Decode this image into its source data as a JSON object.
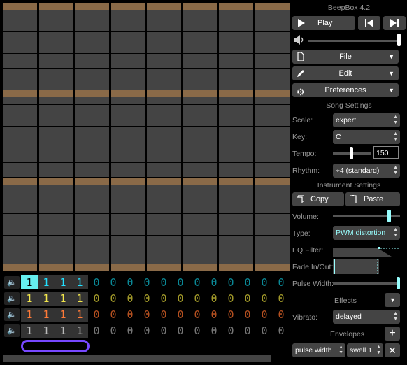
{
  "app": {
    "title": "BeepBox 4.2"
  },
  "transport": {
    "play_label": "Play",
    "play_icon": "play-icon",
    "rewind_icon": "skip-back-icon",
    "forward_icon": "skip-forward-icon",
    "volume_icon": "speaker-icon"
  },
  "menus": {
    "file": "File",
    "edit": "Edit",
    "preferences": "Preferences"
  },
  "song_settings": {
    "heading": "Song Settings",
    "scale_label": "Scale:",
    "scale_value": "expert",
    "key_label": "Key:",
    "key_value": "C",
    "tempo_label": "Tempo:",
    "tempo_value": "150",
    "rhythm_label": "Rhythm:",
    "rhythm_value": "÷4 (standard)"
  },
  "instrument_settings": {
    "heading": "Instrument Settings",
    "copy_label": "Copy",
    "paste_label": "Paste",
    "volume_label": "Volume:",
    "type_label": "Type:",
    "type_value": "PWM distortion",
    "eq_label": "EQ Filter:",
    "fade_label": "Fade In/Out:",
    "pulse_label": "Pulse Width:",
    "effects_label": "Effects",
    "vibrato_label": "Vibrato:",
    "vibrato_value": "delayed",
    "envelopes_label": "Envelopes",
    "envelope_target": "pulse width",
    "envelope_curve": "swell 1"
  },
  "channels": [
    {
      "color": "#22e0ff",
      "dim": "#0a8896",
      "cells": [
        "1",
        "1",
        "1",
        "1",
        "0",
        "0",
        "0",
        "0",
        "0",
        "0",
        "0",
        "0",
        "0",
        "0",
        "0",
        "0"
      ]
    },
    {
      "color": "#f3e74c",
      "dim": "#a29a2a",
      "cells": [
        "1",
        "1",
        "1",
        "1",
        "0",
        "0",
        "0",
        "0",
        "0",
        "0",
        "0",
        "0",
        "0",
        "0",
        "0",
        "0"
      ]
    },
    {
      "color": "#ff7a38",
      "dim": "#b55020",
      "cells": [
        "1",
        "1",
        "1",
        "1",
        "0",
        "0",
        "0",
        "0",
        "0",
        "0",
        "0",
        "0",
        "0",
        "0",
        "0",
        "0"
      ]
    },
    {
      "color": "#bbbbbb",
      "dim": "#777777",
      "cells": [
        "1",
        "1",
        "1",
        "1",
        "0",
        "0",
        "0",
        "0",
        "0",
        "0",
        "0",
        "0",
        "0",
        "0",
        "0",
        "0"
      ]
    }
  ],
  "colors": {
    "accent_selection": "#6ee",
    "loop_outline": "#7748ff",
    "octave_row": "#8a6a48",
    "panel_bg": "#000000"
  }
}
